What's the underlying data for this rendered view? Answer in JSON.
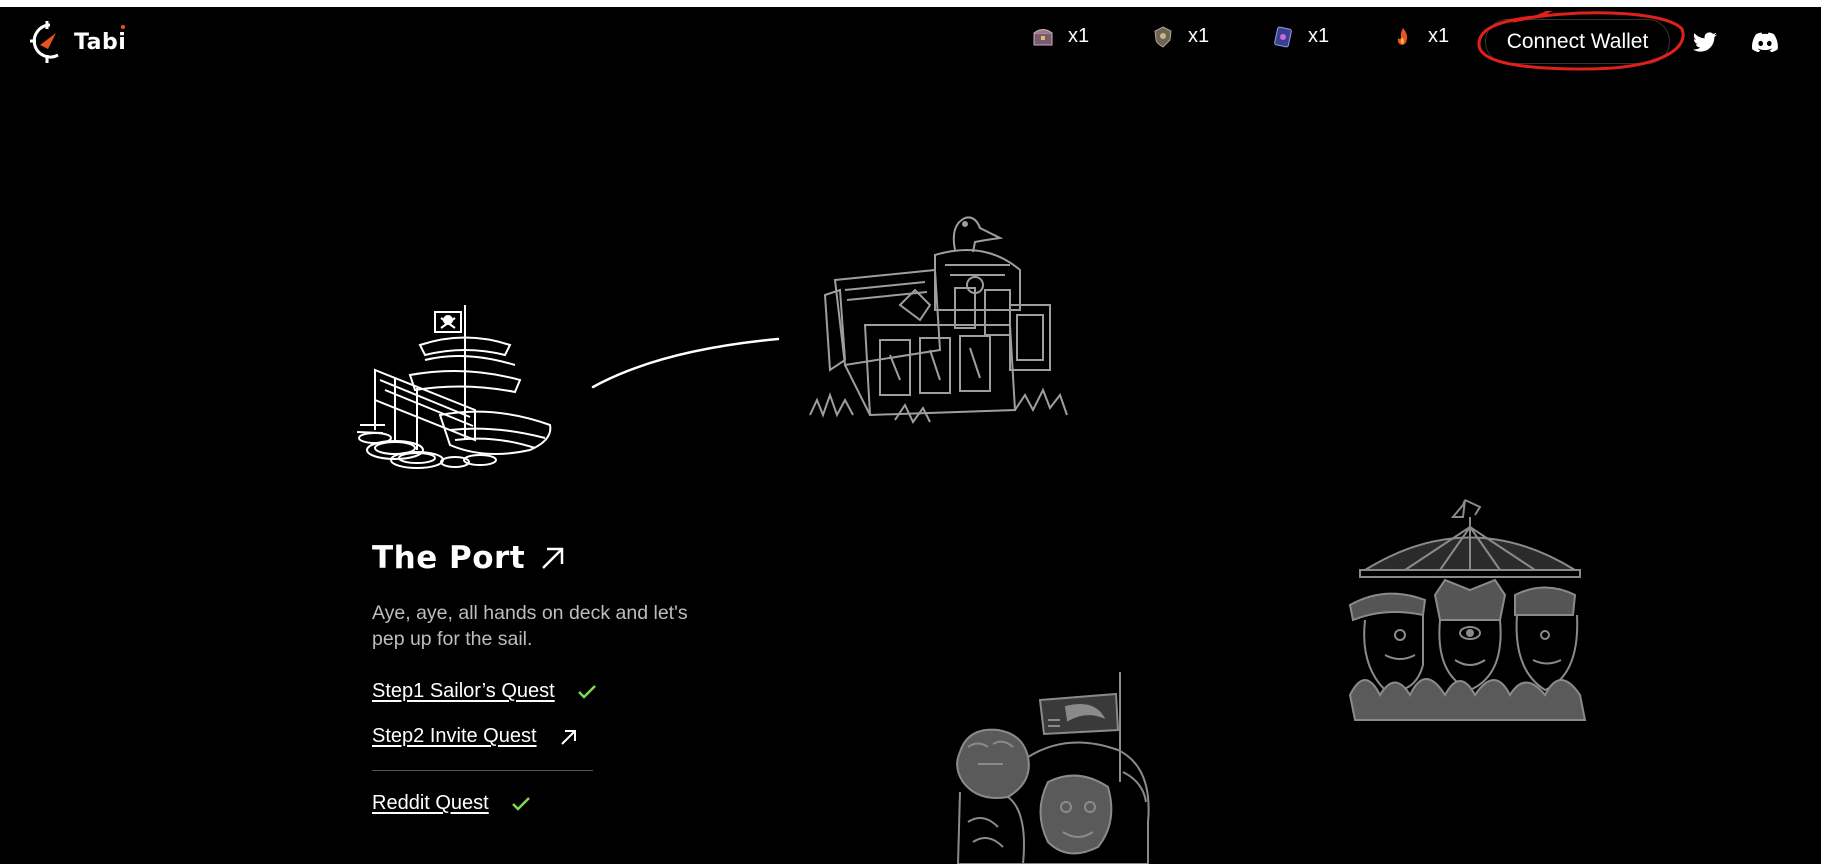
{
  "brand": {
    "name": "Tabi"
  },
  "inventory": [
    {
      "icon": "treasure-chest-icon",
      "count": "x1"
    },
    {
      "icon": "shield-badge-icon",
      "count": "x1"
    },
    {
      "icon": "card-icon",
      "count": "x1"
    },
    {
      "icon": "flame-icon",
      "count": "x1"
    }
  ],
  "header": {
    "connect_label": "Connect Wallet",
    "social": [
      "twitter-icon",
      "discord-icon"
    ]
  },
  "port": {
    "title": "The Port",
    "description": "Aye, aye, all hands on deck and let's pep up for the sail.",
    "quests": [
      {
        "label": "Step1 Sailor’s Quest",
        "status": "done"
      },
      {
        "label": "Step2 Invite Quest",
        "status": "open"
      },
      {
        "label": "Reddit Quest",
        "status": "done"
      }
    ]
  },
  "colors": {
    "background": "#000000",
    "accent": "#e8541e",
    "check": "#7ed957",
    "annotation": "#e0201b",
    "muted_text": "#bdbdbd"
  }
}
